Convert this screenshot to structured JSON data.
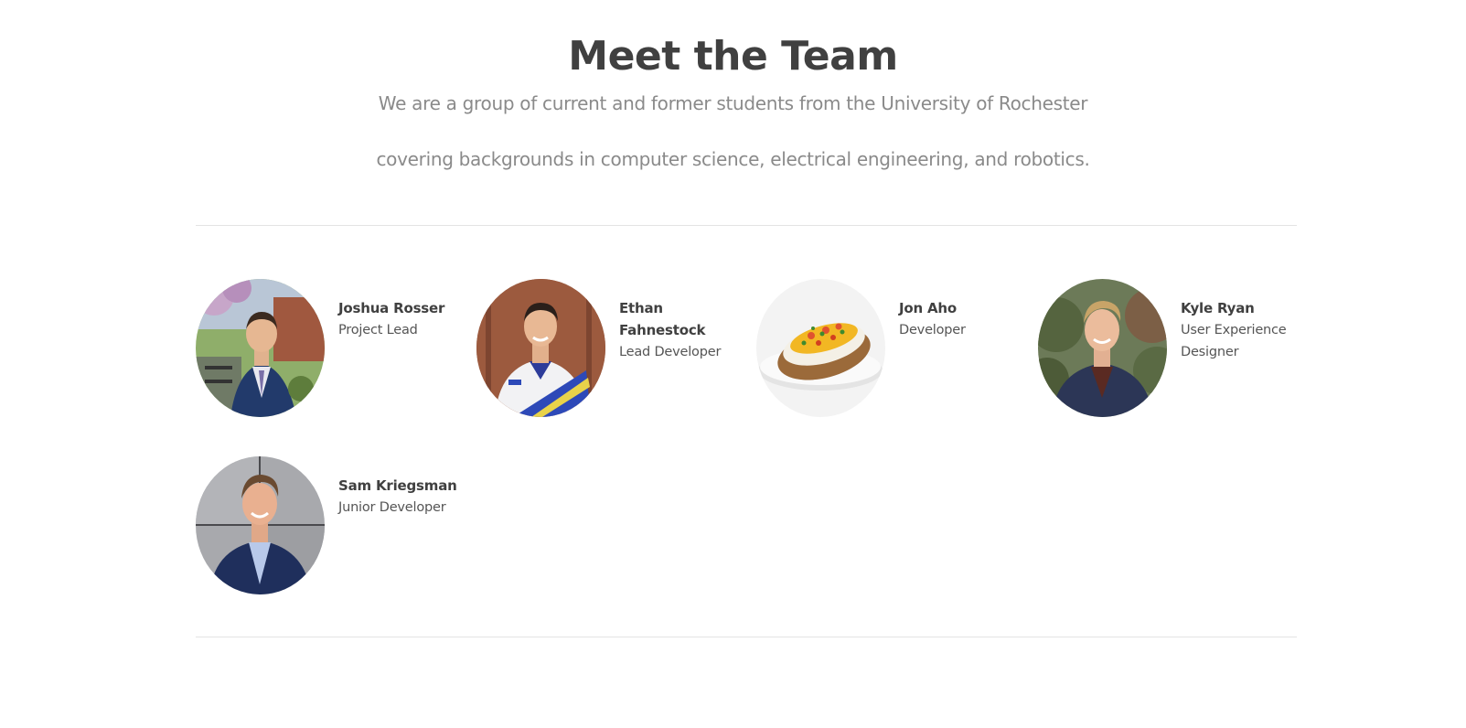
{
  "header": {
    "title": "Meet the Team",
    "subtitle_line1": "We are a group of current and former students from the University of Rochester",
    "subtitle_line2": "covering backgrounds in computer science, electrical engineering, and robotics."
  },
  "team": [
    {
      "name": "Joshua Rosser",
      "role": "Project Lead",
      "photo": "portrait-suit-outdoors"
    },
    {
      "name": "Ethan Fahnestock",
      "role": "Lead Developer",
      "photo": "portrait-polo-shirt"
    },
    {
      "name": "Jon Aho",
      "role": "Developer",
      "photo": "baked-potato"
    },
    {
      "name": "Kyle Ryan",
      "role": "User Experience Designer",
      "photo": "portrait-jacket-outdoors"
    },
    {
      "name": "Sam Kriegsman",
      "role": "Junior Developer",
      "photo": "portrait-suit-wall"
    }
  ]
}
